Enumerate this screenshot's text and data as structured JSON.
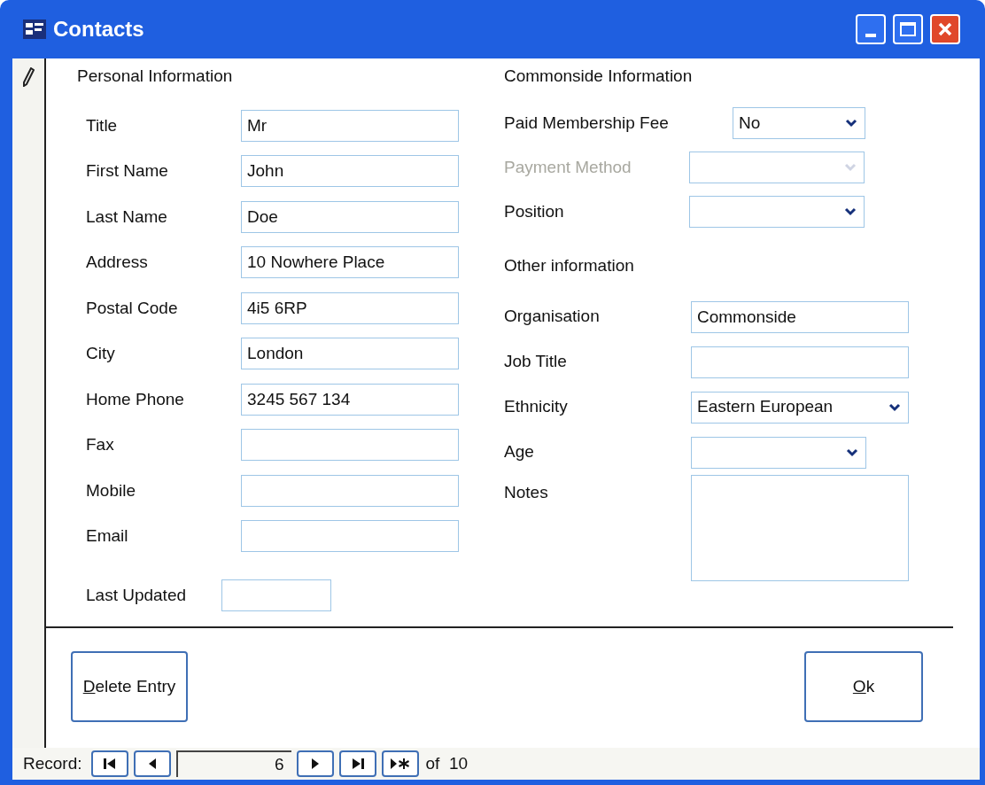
{
  "window": {
    "title": "Contacts"
  },
  "personal": {
    "heading": "Personal Information",
    "fields": [
      {
        "label": "Title",
        "value": "Mr"
      },
      {
        "label": "First Name",
        "value": "John"
      },
      {
        "label": "Last Name",
        "value": "Doe"
      },
      {
        "label": "Address",
        "value": "10 Nowhere Place"
      },
      {
        "label": "Postal Code",
        "value": "4i5 6RP"
      },
      {
        "label": "City",
        "value": "London"
      },
      {
        "label": "Home Phone",
        "value": "3245 567 134"
      },
      {
        "label": "Fax"
      },
      {
        "label": "Mobile"
      },
      {
        "label": "Email"
      }
    ],
    "last_updated": {
      "label": "Last Updated"
    }
  },
  "commonside": {
    "heading": "Commonside Information",
    "fields": [
      {
        "label": "Paid Membership Fee",
        "kind": "combo",
        "value": "No",
        "disabled": false
      },
      {
        "label": "Payment Method",
        "kind": "combo",
        "disabled": true
      },
      {
        "label": "Position",
        "kind": "combo",
        "disabled": false
      }
    ]
  },
  "other": {
    "heading": "Other information",
    "fields": [
      {
        "label": "Organisation",
        "kind": "text",
        "value": "Commonside"
      },
      {
        "label": "Job Title",
        "kind": "text"
      },
      {
        "label": "Ethnicity",
        "kind": "combo",
        "value": "Eastern European"
      },
      {
        "label": "Age",
        "kind": "combo"
      },
      {
        "label": "Notes",
        "kind": "memo"
      }
    ]
  },
  "buttons": [
    {
      "label": "Delete Entry"
    },
    {
      "label": "Ok"
    }
  ],
  "navigator": {
    "label": "Record:",
    "current": "6",
    "total": "of  10"
  }
}
